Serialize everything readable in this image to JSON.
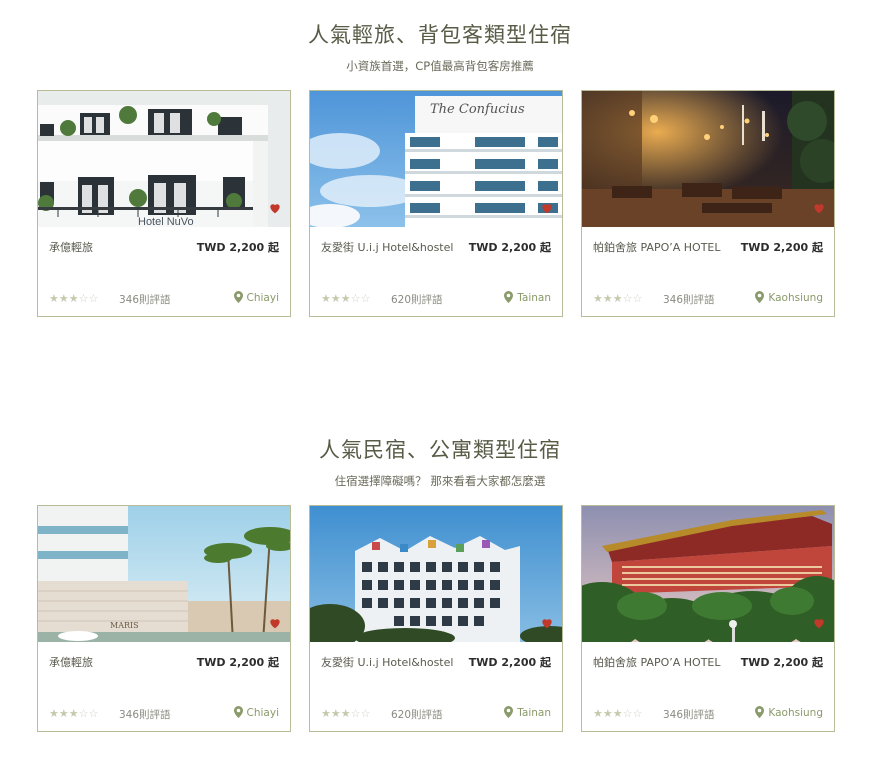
{
  "sections": [
    {
      "title": "人氣輕旅、背包客類型住宿",
      "subtitle": "小資族首選，CP值最高背包客房推薦",
      "cards": [
        {
          "name": "承億輕旅",
          "price": "TWD 2,200 起",
          "rating": 3,
          "reviews": "346則評語",
          "location": "Chiayi"
        },
        {
          "name": "友愛街 U.i.j Hotel&hostel",
          "price": "TWD 2,200 起",
          "rating": 3,
          "reviews": "620則評語",
          "location": "Tainan"
        },
        {
          "name": "帕鉑舍旅 PAPO’A HOTEL",
          "price": "TWD 2,200 起",
          "rating": 3,
          "reviews": "346則評語",
          "location": "Kaohsiung"
        }
      ]
    },
    {
      "title": "人氣民宿、公寓類型住宿",
      "subtitle": "住宿選擇障礙嗎？ 那來看看大家都怎麼選",
      "cards": [
        {
          "name": "承億輕旅",
          "price": "TWD 2,200 起",
          "rating": 3,
          "reviews": "346則評語",
          "location": "Chiayi"
        },
        {
          "name": "友愛街 U.i.j Hotel&hostel",
          "price": "TWD 2,200 起",
          "rating": 3,
          "reviews": "620則評語",
          "location": "Tainan"
        },
        {
          "name": "帕鉑舍旅 PAPO’A HOTEL",
          "price": "TWD 2,200 起",
          "rating": 3,
          "reviews": "346則評語",
          "location": "Kaohsiung"
        }
      ]
    }
  ],
  "photo_signs": {
    "hotel_nuvo": "Hotel NuVo",
    "confucius": "The Confucius",
    "maris": "MARIS"
  },
  "colors": {
    "border": "#b8bc96",
    "heart": "#c0392b",
    "pin": "#8a9a6a",
    "title": "#585b45"
  },
  "icons": {
    "favorite": "heart-icon",
    "location": "map-pin-icon",
    "rating": "star-icon"
  }
}
